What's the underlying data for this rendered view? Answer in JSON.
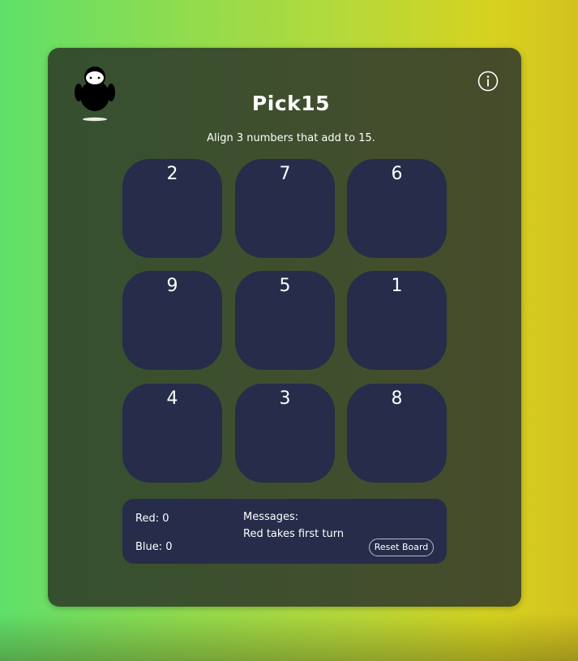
{
  "title": "Pick15",
  "subtitle": "Align 3 numbers that add to 15.",
  "board": {
    "cells": [
      "2",
      "7",
      "6",
      "9",
      "5",
      "1",
      "4",
      "3",
      "8"
    ]
  },
  "status": {
    "red_label": "Red: 0",
    "blue_label": "Blue: 0",
    "messages_label": "Messages:",
    "message": "Red takes first turn",
    "reset_label": "Reset Board"
  },
  "icons": {
    "mascot": "robot-mascot-icon",
    "info": "info-icon"
  },
  "colors": {
    "panel": "#3f4f2e",
    "cell": "#262c4a",
    "text": "#ffffff"
  }
}
